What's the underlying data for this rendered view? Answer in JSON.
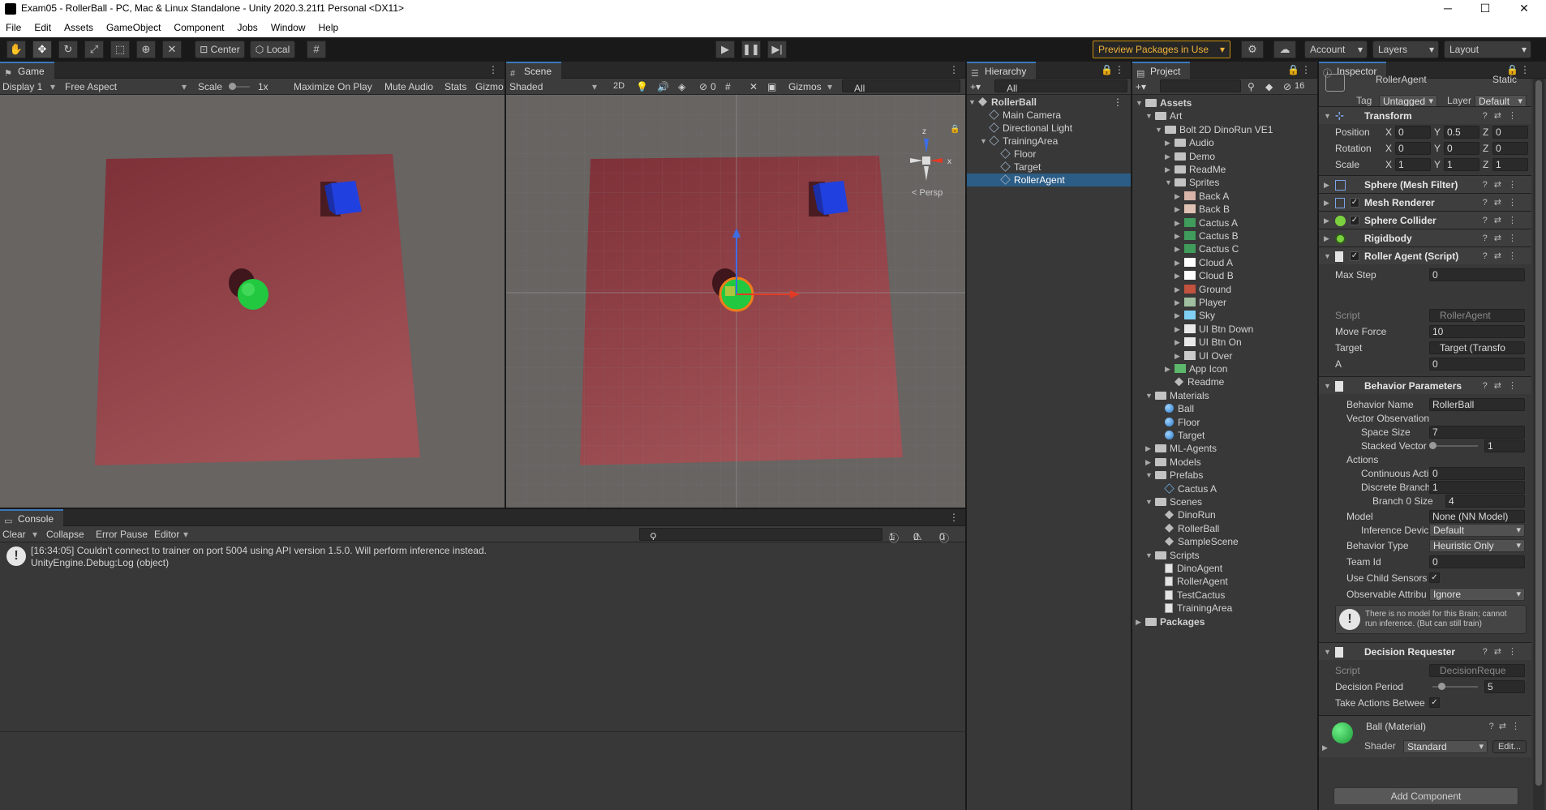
{
  "window": {
    "title": "Exam05 - RollerBall - PC, Mac & Linux Standalone - Unity 2020.3.21f1 Personal <DX11>",
    "minimize": "─",
    "maximize": "☐",
    "close": "✕"
  },
  "menu": [
    "File",
    "Edit",
    "Assets",
    "GameObject",
    "Component",
    "Jobs",
    "Window",
    "Help"
  ],
  "toolbar": {
    "pivot": "Center",
    "space": "Local",
    "preview_packages": "Preview Packages in Use",
    "account": "Account",
    "layers": "Layers",
    "layout": "Layout"
  },
  "game": {
    "tab": "Game",
    "display": "Display 1",
    "aspect": "Free Aspect",
    "scale_label": "Scale",
    "scale_value": "1x",
    "maximize": "Maximize On Play",
    "mute": "Mute Audio",
    "stats": "Stats",
    "gizmos": "Gizmo"
  },
  "scene": {
    "tab": "Scene",
    "shading": "Shaded",
    "mode2d": "2D",
    "hidden_count": "0",
    "gizmos": "Gizmos",
    "search_placeholder": "All",
    "persp": "< Persp",
    "axis_x": "x",
    "axis_z": "z"
  },
  "hierarchy": {
    "tab": "Hierarchy",
    "search_placeholder": "All",
    "items": [
      {
        "label": "RollerBall",
        "depth": 0,
        "type": "scene",
        "expanded": true
      },
      {
        "label": "Main Camera",
        "depth": 1,
        "type": "go"
      },
      {
        "label": "Directional Light",
        "depth": 1,
        "type": "go"
      },
      {
        "label": "TrainingArea",
        "depth": 1,
        "type": "go",
        "expanded": true
      },
      {
        "label": "Floor",
        "depth": 2,
        "type": "go"
      },
      {
        "label": "Target",
        "depth": 2,
        "type": "go"
      },
      {
        "label": "RollerAgent",
        "depth": 2,
        "type": "go",
        "selected": true
      }
    ]
  },
  "project": {
    "tab": "Project",
    "hidden_count": "16",
    "items": [
      {
        "label": "Assets",
        "depth": 0,
        "type": "folder",
        "caret": "open",
        "bold": true
      },
      {
        "label": "Art",
        "depth": 1,
        "type": "folder",
        "caret": "open"
      },
      {
        "label": "Bolt 2D DinoRun VE1",
        "depth": 2,
        "type": "folder",
        "caret": "open"
      },
      {
        "label": "Audio",
        "depth": 3,
        "type": "folder",
        "caret": "closed"
      },
      {
        "label": "Demo",
        "depth": 3,
        "type": "folder",
        "caret": "closed"
      },
      {
        "label": "ReadMe",
        "depth": 3,
        "type": "folder",
        "caret": "closed"
      },
      {
        "label": "Sprites",
        "depth": 3,
        "type": "folder",
        "caret": "open"
      },
      {
        "label": "Back A",
        "depth": 4,
        "type": "sprite",
        "caret": "closed",
        "color": "#d7b3a8"
      },
      {
        "label": "Back B",
        "depth": 4,
        "type": "sprite",
        "caret": "closed",
        "color": "#e0c2b5"
      },
      {
        "label": "Cactus A",
        "depth": 4,
        "type": "sprite",
        "caret": "closed",
        "color": "#3f9c5b"
      },
      {
        "label": "Cactus B",
        "depth": 4,
        "type": "sprite",
        "caret": "closed",
        "color": "#3f9c5b"
      },
      {
        "label": "Cactus C",
        "depth": 4,
        "type": "sprite",
        "caret": "closed",
        "color": "#3f9c5b"
      },
      {
        "label": "Cloud A",
        "depth": 4,
        "type": "sprite",
        "caret": "closed",
        "color": "#ffffff"
      },
      {
        "label": "Cloud B",
        "depth": 4,
        "type": "sprite",
        "caret": "closed",
        "color": "#ffffff"
      },
      {
        "label": "Ground",
        "depth": 4,
        "type": "sprite",
        "caret": "closed",
        "color": "#c2523e"
      },
      {
        "label": "Player",
        "depth": 4,
        "type": "sprite",
        "caret": "closed",
        "color": "#9fbfa0"
      },
      {
        "label": "Sky",
        "depth": 4,
        "type": "sprite",
        "caret": "closed",
        "color": "#7fd0f2"
      },
      {
        "label": "UI Btn Down",
        "depth": 4,
        "type": "sprite",
        "caret": "closed",
        "color": "#e8e8e8"
      },
      {
        "label": "UI Btn On",
        "depth": 4,
        "type": "sprite",
        "caret": "closed",
        "color": "#e8e8e8"
      },
      {
        "label": "UI Over",
        "depth": 4,
        "type": "sprite",
        "caret": "closed",
        "color": "#cccccc"
      },
      {
        "label": "App Icon",
        "depth": 3,
        "type": "sprite",
        "caret": "closed",
        "color": "#5cb86a"
      },
      {
        "label": "Readme",
        "depth": 3,
        "type": "scene",
        "caret": "none"
      },
      {
        "label": "Materials",
        "depth": 1,
        "type": "folder",
        "caret": "open"
      },
      {
        "label": "Ball",
        "depth": 2,
        "type": "material",
        "caret": "none"
      },
      {
        "label": "Floor",
        "depth": 2,
        "type": "material",
        "caret": "none"
      },
      {
        "label": "Target",
        "depth": 2,
        "type": "material",
        "caret": "none"
      },
      {
        "label": "ML-Agents",
        "depth": 1,
        "type": "folder",
        "caret": "closed"
      },
      {
        "label": "Models",
        "depth": 1,
        "type": "folder",
        "caret": "closed"
      },
      {
        "label": "Prefabs",
        "depth": 1,
        "type": "folder",
        "caret": "open"
      },
      {
        "label": "Cactus A",
        "depth": 2,
        "type": "prefab",
        "caret": "none"
      },
      {
        "label": "Scenes",
        "depth": 1,
        "type": "folder",
        "caret": "open"
      },
      {
        "label": "DinoRun",
        "depth": 2,
        "type": "scene",
        "caret": "none"
      },
      {
        "label": "RollerBall",
        "depth": 2,
        "type": "scene",
        "caret": "none"
      },
      {
        "label": "SampleScene",
        "depth": 2,
        "type": "scene",
        "caret": "none"
      },
      {
        "label": "Scripts",
        "depth": 1,
        "type": "folder",
        "caret": "open"
      },
      {
        "label": "DinoAgent",
        "depth": 2,
        "type": "script",
        "caret": "none"
      },
      {
        "label": "RollerAgent",
        "depth": 2,
        "type": "script",
        "caret": "none"
      },
      {
        "label": "TestCactus",
        "depth": 2,
        "type": "script",
        "caret": "none"
      },
      {
        "label": "TrainingArea",
        "depth": 2,
        "type": "script",
        "caret": "none"
      },
      {
        "label": "Packages",
        "depth": 0,
        "type": "folder",
        "caret": "closed",
        "bold": true
      }
    ]
  },
  "inspector": {
    "tab": "Inspector",
    "object_name": "RollerAgent",
    "static_label": "Static",
    "tag_label": "Tag",
    "tag_value": "Untagged",
    "layer_label": "Layer",
    "layer_value": "Default",
    "transform": {
      "title": "Transform",
      "rows": [
        {
          "label": "Position",
          "x": "0",
          "y": "0.5",
          "z": "0"
        },
        {
          "label": "Rotation",
          "x": "0",
          "y": "0",
          "z": "0"
        },
        {
          "label": "Scale",
          "x": "1",
          "y": "1",
          "z": "1"
        }
      ]
    },
    "mesh_filter": "Sphere (Mesh Filter)",
    "mesh_renderer": "Mesh Renderer",
    "sphere_collider": "Sphere Collider",
    "rigidbody": "Rigidbody",
    "roller_agent": {
      "title": "Roller Agent (Script)",
      "max_step_label": "Max Step",
      "max_step": "0",
      "script_label": "Script",
      "script_value": "RollerAgent",
      "move_force_label": "Move Force",
      "move_force": "10",
      "target_label": "Target",
      "target_value": "Target (Transfo",
      "a_label": "A",
      "a_value": "0"
    },
    "behavior": {
      "title": "Behavior Parameters",
      "name_label": "Behavior Name",
      "name_value": "RollerBall",
      "vector_obs": "Vector Observation",
      "space_size_label": "Space Size",
      "space_size": "7",
      "stacked_label": "Stacked Vector",
      "stacked_value": "1",
      "stacked_fraction": 0,
      "actions": "Actions",
      "continuous_label": "Continuous Acti",
      "continuous_value": "0",
      "discrete_label": "Discrete Branch",
      "discrete_value": "1",
      "branch0_label": "Branch 0 Size",
      "branch0_value": "4",
      "model_label": "Model",
      "model_value": "None (NN Model)",
      "inference_label": "Inference Devic",
      "inference_value": "Default",
      "behavior_type_label": "Behavior Type",
      "behavior_type_value": "Heuristic Only",
      "team_id_label": "Team Id",
      "team_id": "0",
      "child_sensors_label": "Use Child Sensors",
      "child_sensors_checked": "✓",
      "observable_label": "Observable Attribu",
      "observable_value": "Ignore",
      "help_text_1": "There is no model for this Brain; cannot",
      "help_text_2": "run inference. (But can still train)"
    },
    "decision": {
      "title": "Decision Requester",
      "script_label": "Script",
      "script_value": "DecisionReque",
      "period_label": "Decision Period",
      "period_value": "5",
      "period_fraction": 0.2,
      "take_actions_label": "Take Actions Betwee",
      "take_actions_checked": "✓"
    },
    "material": {
      "name": "Ball (Material)",
      "shader_label": "Shader",
      "shader_value": "Standard",
      "edit": "Edit..."
    },
    "add_component": "Add Component"
  },
  "console": {
    "tab": "Console",
    "clear": "Clear",
    "collapse": "Collapse",
    "error_pause": "Error Pause",
    "editor": "Editor",
    "count_info": "1",
    "count_warn": "0",
    "count_error": "0",
    "log_line1": "[16:34:05] Couldn't connect to trainer on port 5004 using API version 1.5.0. Will perform inference instead.",
    "log_line2": "UnityEngine.Debug:Log (object)"
  },
  "colors": {
    "accent": "#3a79bb",
    "selection": "#2c5d87",
    "preview_warning": "#f2b43a",
    "floor": "#8a3b42",
    "cube": "#1f3fd6",
    "sphere": "#22c940"
  }
}
